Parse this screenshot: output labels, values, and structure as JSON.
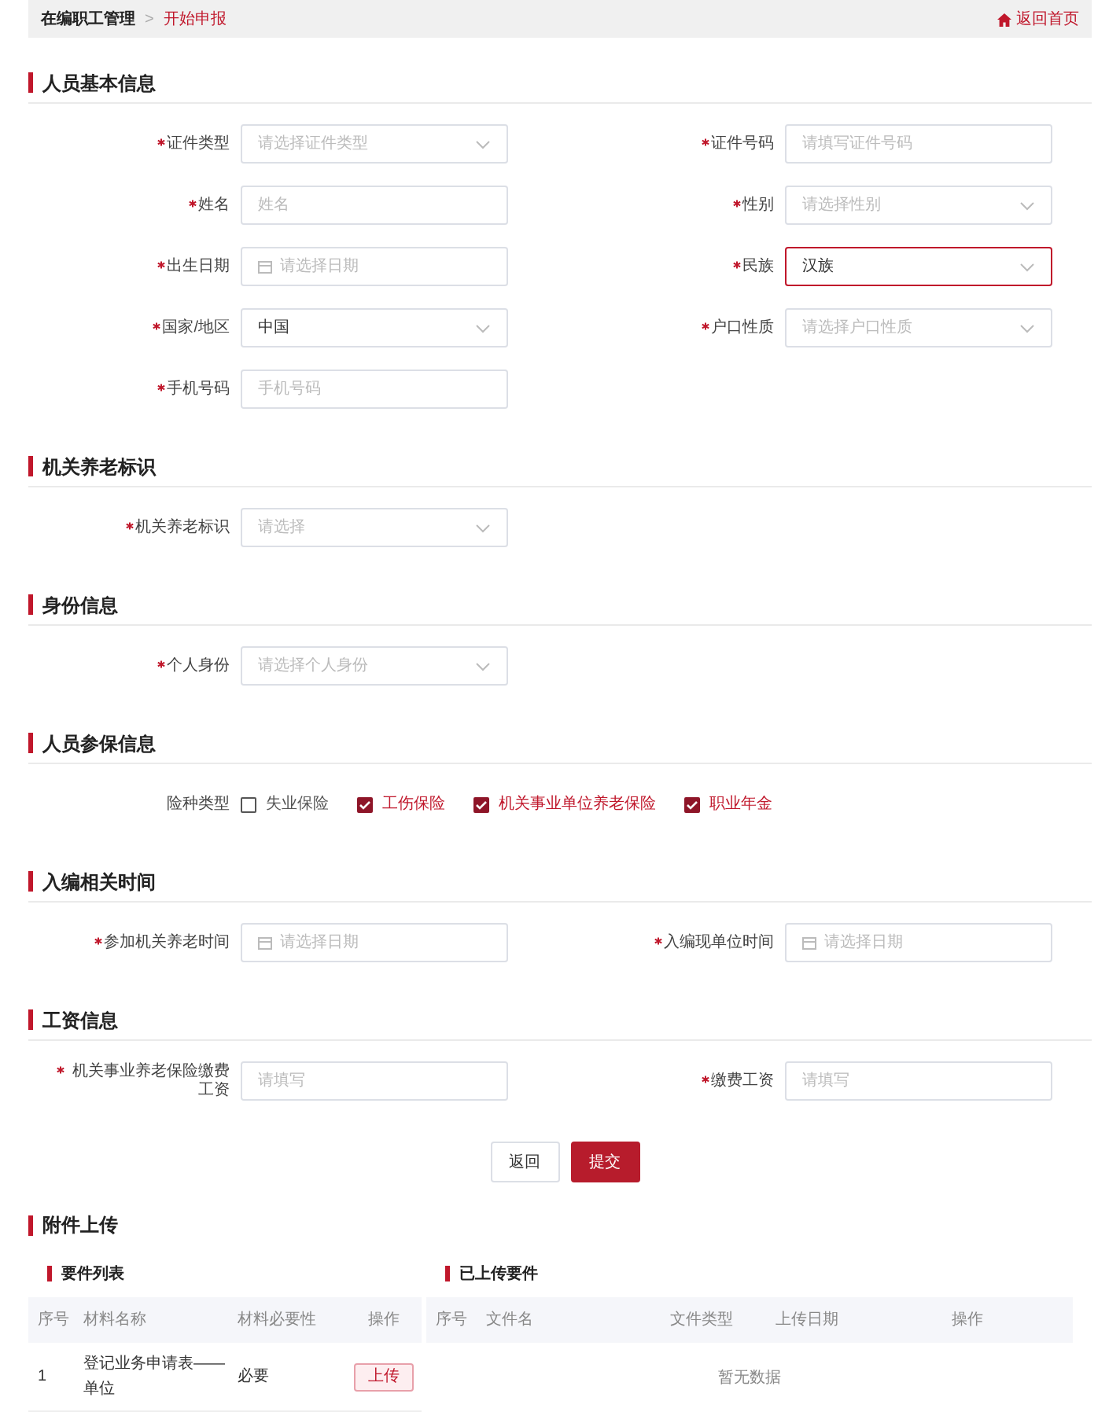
{
  "breadcrumb": {
    "items": [
      {
        "label": "在编职工管理",
        "current": false
      },
      {
        "label": "开始申报",
        "current": true
      }
    ],
    "separator": ">"
  },
  "home_link": "返回首页",
  "sections": [
    {
      "title": "人员基本信息",
      "kind": "form",
      "fields": [
        {
          "label": "证件类型",
          "required": true,
          "kind": "select",
          "placeholder": "请选择证件类型",
          "focused": false
        },
        {
          "label": "证件号码",
          "required": true,
          "kind": "text",
          "placeholder": "请填写证件号码",
          "focused": false
        },
        {
          "label": "姓名",
          "required": true,
          "kind": "text",
          "placeholder": "姓名",
          "focused": false
        },
        {
          "label": "性别",
          "required": true,
          "kind": "select",
          "placeholder": "请选择性别",
          "focused": false
        },
        {
          "label": "出生日期",
          "required": true,
          "kind": "date",
          "placeholder": "请选择日期",
          "focused": false
        },
        {
          "label": "民族",
          "required": true,
          "kind": "select",
          "value": "汉族",
          "focused": true
        },
        {
          "label": "国家/地区",
          "required": true,
          "kind": "select",
          "value": "中国",
          "focused": false
        },
        {
          "label": "户口性质",
          "required": true,
          "kind": "select",
          "placeholder": "请选择户口性质",
          "focused": false
        },
        {
          "label": "手机号码",
          "required": true,
          "kind": "text",
          "placeholder": "手机号码",
          "focused": false
        }
      ]
    },
    {
      "title": "机关养老标识",
      "kind": "form",
      "fields": [
        {
          "label": "机关养老标识",
          "required": true,
          "kind": "select",
          "placeholder": "请选择",
          "focused": false
        }
      ]
    },
    {
      "title": "身份信息",
      "kind": "form",
      "fields": [
        {
          "label": "个人身份",
          "required": true,
          "kind": "select",
          "placeholder": "请选择个人身份",
          "focused": false
        }
      ]
    },
    {
      "title": "人员参保信息",
      "kind": "checkboxes",
      "label": "险种类型",
      "options": [
        {
          "label": "失业保险",
          "checked": false
        },
        {
          "label": "工伤保险",
          "checked": true
        },
        {
          "label": "机关事业单位养老保险",
          "checked": true
        },
        {
          "label": "职业年金",
          "checked": true
        }
      ]
    },
    {
      "title": "入编相关时间",
      "kind": "form",
      "fields": [
        {
          "label": "参加机关养老时间",
          "required": true,
          "kind": "date",
          "placeholder": "请选择日期",
          "focused": false
        },
        {
          "label": "入编现单位时间",
          "required": true,
          "kind": "date",
          "placeholder": "请选择日期",
          "focused": false
        }
      ]
    },
    {
      "title": "工资信息",
      "kind": "form",
      "fields": [
        {
          "label": "机关事业养老保险缴费工资",
          "required": true,
          "kind": "text",
          "placeholder": "请填写",
          "focused": false
        },
        {
          "label": "缴费工资",
          "required": true,
          "kind": "text",
          "placeholder": "请填写",
          "focused": false
        }
      ]
    }
  ],
  "actions": [
    {
      "label": "返回",
      "kind": "secondary"
    },
    {
      "label": "提交",
      "kind": "primary"
    }
  ],
  "attachments": {
    "title": "附件上传",
    "required_list": {
      "title": "要件列表",
      "columns": [
        "序号",
        "材料名称",
        "材料必要性",
        "操作"
      ],
      "rows": [
        {
          "cells": [
            "1",
            "登记业务申请表——单位",
            "必要"
          ],
          "action": "上传"
        }
      ]
    },
    "uploaded": {
      "title": "已上传要件",
      "columns": [
        "序号",
        "文件名",
        "文件类型",
        "上传日期",
        "操作"
      ],
      "empty_text": "暂无数据"
    }
  }
}
